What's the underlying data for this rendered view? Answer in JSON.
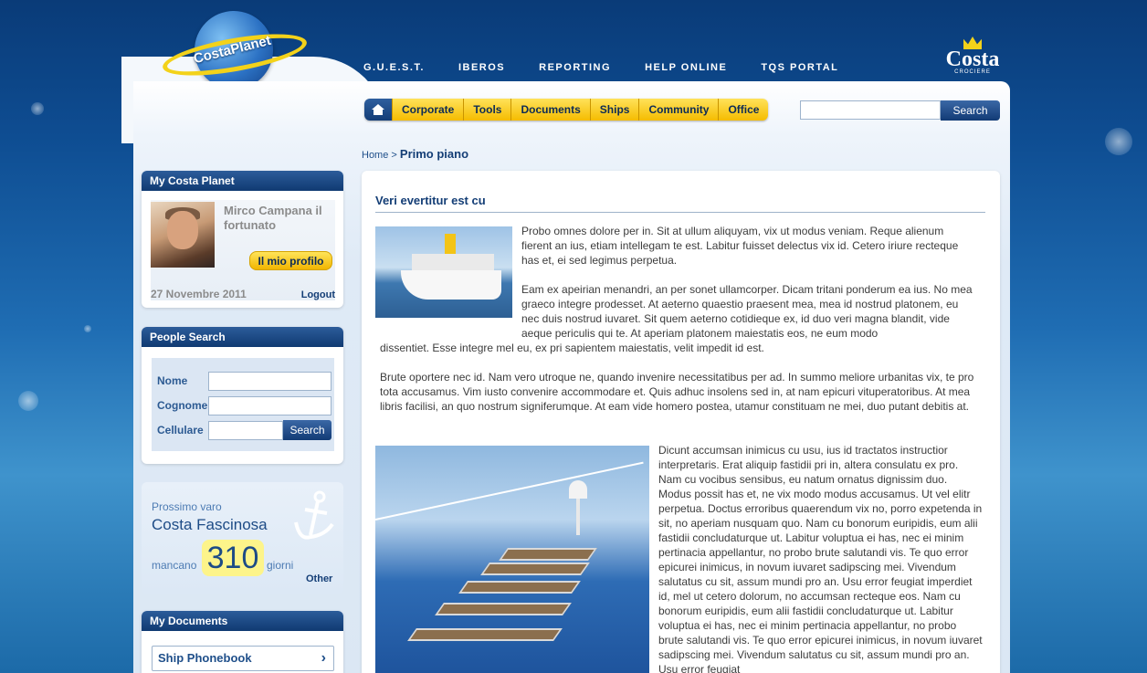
{
  "header": {
    "brand": "CostaPlanet",
    "logo_text": "Costa",
    "logo_sub": "CROCIERE",
    "top_nav": [
      "G.U.E.S.T.",
      "IBEROS",
      "REPORTING",
      "HELP ONLINE",
      "TQS PORTAL"
    ]
  },
  "menu": {
    "items": [
      "Corporate",
      "Tools",
      "Documents",
      "Ships",
      "Community",
      "Office"
    ],
    "search_button": "Search",
    "search_value": ""
  },
  "breadcrumb": {
    "home": "Home",
    "separator": ">",
    "current": "Primo piano"
  },
  "profile": {
    "title": "My Costa Planet",
    "name": "Mirco Campana il fortunato",
    "button": "Il mio profilo",
    "date": "27 Novembre 2011",
    "logout": "Logout"
  },
  "people_search": {
    "title": "People Search",
    "fields": [
      "Nome",
      "Cognome",
      "Cellulare"
    ],
    "button": "Search"
  },
  "next_launch": {
    "label": "Prossimo varo",
    "ship": "Costa Fascinosa",
    "prefix": "mancano",
    "days": "310",
    "suffix": "giorni",
    "other": "Other"
  },
  "documents": {
    "title": "My Documents",
    "link": "Ship Phonebook",
    "arrow": "›"
  },
  "article": {
    "title": "Veri evertitur est cu",
    "p1": "Probo omnes dolore per in. Sit at ullum aliquyam, vix ut modus veniam. Reque alienum fierent an ius, etiam intellegam te est. Labitur fuisset delectus vix id. Cetero iriure recteque has et, ei sed legimus perpetua.",
    "p2": "Eam ex apeirian menandri, an per sonet ullamcorper. Dicam tritani ponderum ea ius. No mea graeco integre prodesset. At aeterno quaestio praesent mea, mea id nostrud platonem, eu nec duis nostrud iuvaret. Sit quem aeterno cotidieque ex, id duo veri magna blandit, vide aeque periculis qui te. At aperiam platonem maiestatis eos, ne eum modo",
    "p2_end": "dissentiet. Esse integre mel eu, ex pri sapientem maiestatis, velit impedit id est.",
    "p3": "Brute oportere nec id. Nam vero utroque ne, quando invenire necessitatibus per ad. In summo meliore urbanitas vix, te pro tota accusamus. Vim iusto convenire accommodare et. Quis adhuc insolens sed in, at nam epicuri vituperatoribus. At mea libris facilisi, an quo nostrum signiferumque. At eam vide homero postea, utamur constituam ne mei, duo putant debitis at.",
    "p4": "Dicunt accumsan inimicus cu usu, ius id tractatos instructior interpretaris. Erat aliquip fastidii pri in, altera consulatu ex pro. Nam cu vocibus sensibus, eu natum ornatus dignissim duo. Modus possit has et, ne vix modo modus accusamus. Ut vel elitr perpetua. Doctus erroribus quaerendum vix no, porro expetenda in sit, no aperiam nusquam quo. Nam cu bonorum euripidis, eum alii fastidii concludaturque ut. Labitur voluptua ei has, nec ei minim pertinacia appellantur, no probo brute salutandi vis. Te quo error epicurei inimicus, in novum iuvaret sadipscing mei. Vivendum salutatus cu sit, assum mundi pro an. Usu error feugiat imperdiet id, mel ut cetero dolorum, no accumsan recteque eos. Nam cu bonorum euripidis, eum alii fastidii concludaturque ut. Labitur voluptua ei has, nec ei minim pertinacia appellantur, no probo brute salutandi vis. Te quo error epicurei inimicus, in novum iuvaret sadipscing mei. Vivendum salutatus cu sit, assum mundi pro an. Usu error feugiat"
  },
  "colors": {
    "navy": "#143e76",
    "yellow": "#f5bc00",
    "background": "#0e4d92"
  }
}
